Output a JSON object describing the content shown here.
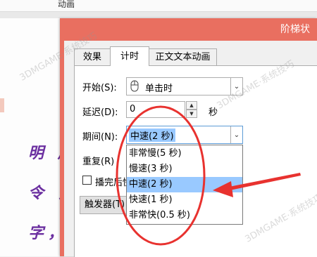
{
  "ribbon": {
    "label": "动画"
  },
  "slide": {
    "lines": [
      "明 居",
      "令 夕",
      "字，"
    ]
  },
  "dialog": {
    "title": "阶梯状",
    "tabs": [
      {
        "label": "效果"
      },
      {
        "label": "计时"
      },
      {
        "label": "正文文本动画"
      }
    ],
    "start": {
      "label": "开始(S):",
      "value": "单击时"
    },
    "delay": {
      "label": "延迟(D):",
      "value": "0",
      "unit": "秒"
    },
    "duration": {
      "label": "期间(N):",
      "value": "中速(2 秒)",
      "options": [
        "非常慢(5 秒)",
        "慢速(3 秒)",
        "中速(2 秒)",
        "快速(1 秒)",
        "非常快(0.5 秒)"
      ],
      "selected_index": 2
    },
    "repeat": {
      "label": "重复(R)"
    },
    "rewind": {
      "label": "播完后快"
    },
    "trigger": {
      "label": "触发器(T)"
    }
  },
  "watermark": {
    "text": "3DMGAME·系统技巧"
  },
  "colors": {
    "title_bar": "#e96f60",
    "selection": "#99c9ff",
    "annotation": "#e8322f",
    "slide_text": "#6b2fa0"
  },
  "icons": [
    "mouse-icon",
    "chevron-down-icon",
    "spin-up-icon",
    "spin-down-icon",
    "arrow-annotation-icon"
  ]
}
